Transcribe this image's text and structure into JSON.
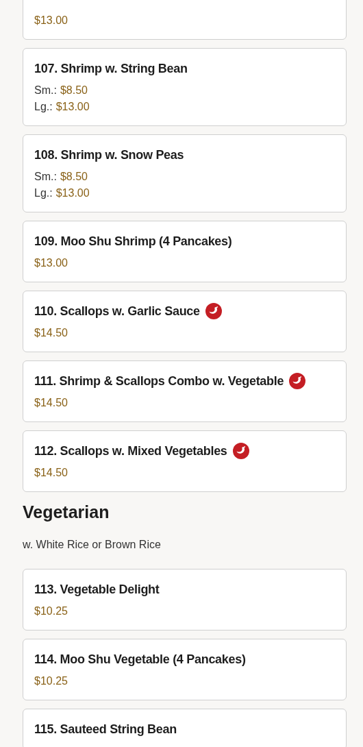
{
  "sections": [
    {
      "items": [
        {
          "spicy": false,
          "prices": [
            {
              "amount": "$13.00"
            }
          ]
        },
        {
          "name": "107. Shrimp w. String Bean",
          "spicy": false,
          "prices": [
            {
              "size": "Sm.:",
              "amount": "$8.50"
            },
            {
              "size": "Lg.:",
              "amount": "$13.00"
            }
          ]
        },
        {
          "name": "108. Shrimp w. Snow Peas",
          "spicy": false,
          "prices": [
            {
              "size": "Sm.:",
              "amount": "$8.50"
            },
            {
              "size": "Lg.:",
              "amount": "$13.00"
            }
          ]
        },
        {
          "name": "109. Moo Shu Shrimp (4 Pancakes)",
          "spicy": false,
          "prices": [
            {
              "amount": "$13.00"
            }
          ]
        },
        {
          "name": "110. Scallops w. Garlic Sauce",
          "spicy": true,
          "prices": [
            {
              "amount": "$14.50"
            }
          ]
        },
        {
          "name": "111. Shrimp & Scallops Combo w. Vegetable",
          "spicy": true,
          "prices": [
            {
              "amount": "$14.50"
            }
          ]
        },
        {
          "name": "112. Scallops w. Mixed Vegetables",
          "spicy": true,
          "prices": [
            {
              "amount": "$14.50"
            }
          ]
        }
      ]
    },
    {
      "heading": "Vegetarian",
      "note": "w. White Rice or Brown Rice",
      "items": [
        {
          "name": "113. Vegetable Delight",
          "spicy": false,
          "prices": [
            {
              "amount": "$10.25"
            }
          ]
        },
        {
          "name": "114. Moo Shu Vegetable (4 Pancakes)",
          "spicy": false,
          "prices": [
            {
              "amount": "$10.25"
            }
          ]
        },
        {
          "name": "115. Sauteed String Bean",
          "spicy": false
        }
      ]
    }
  ]
}
